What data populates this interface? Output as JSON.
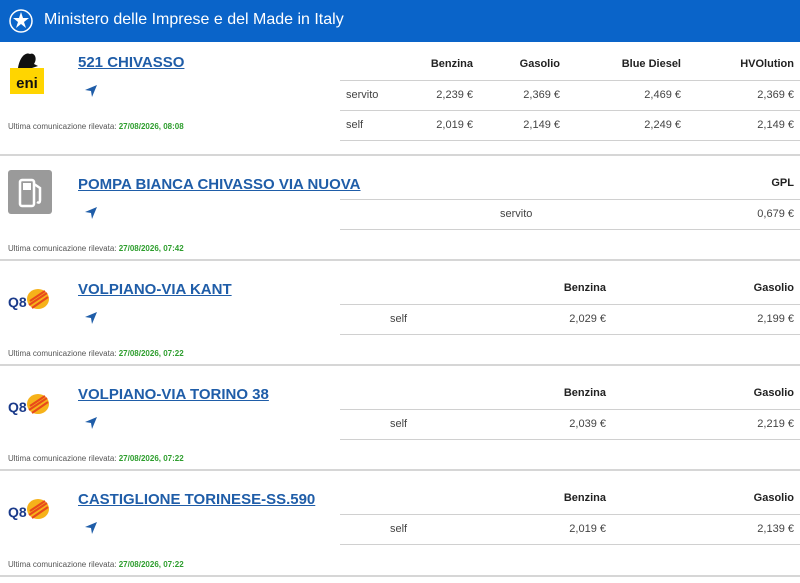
{
  "header": {
    "title": "Ministero delle Imprese e del Made in Italy"
  },
  "stations": [
    {
      "brand": "eni",
      "name": "521 CHIVASSO",
      "updated_label": "Ultima comunicazione rilevata:",
      "updated_value": "27/08/2026, 08:08",
      "fuels": [
        "Benzina",
        "Gasolio",
        "Blue Diesel",
        "HVOlution"
      ],
      "rows": [
        {
          "service": "servito",
          "prices": [
            "2,239 €",
            "2,369 €",
            "2,469 €",
            "2,369 €"
          ]
        },
        {
          "service": "self",
          "prices": [
            "2,019 €",
            "2,149 €",
            "2,249 €",
            "2,149 €"
          ]
        }
      ]
    },
    {
      "brand": "pompa-bianca",
      "name": "POMPA BIANCA CHIVASSO VIA NUOVA",
      "updated_label": "Ultima comunicazione rilevata:",
      "updated_value": "27/08/2026, 07:42",
      "fuels": [
        "GPL"
      ],
      "rows": [
        {
          "service": "servito",
          "prices": [
            "0,679 €"
          ]
        }
      ]
    },
    {
      "brand": "q8",
      "name": "VOLPIANO-VIA KANT",
      "updated_label": "Ultima comunicazione rilevata:",
      "updated_value": "27/08/2026, 07:22",
      "fuels": [
        "Benzina",
        "Gasolio"
      ],
      "rows": [
        {
          "service": "self",
          "prices": [
            "2,029 €",
            "2,199 €"
          ]
        }
      ]
    },
    {
      "brand": "q8",
      "name": "VOLPIANO-VIA TORINO 38",
      "updated_label": "Ultima comunicazione rilevata:",
      "updated_value": "27/08/2026, 07:22",
      "fuels": [
        "Benzina",
        "Gasolio"
      ],
      "rows": [
        {
          "service": "self",
          "prices": [
            "2,039 €",
            "2,219 €"
          ]
        }
      ]
    },
    {
      "brand": "q8",
      "name": "CASTIGLIONE TORINESE-SS.590",
      "updated_label": "Ultima comunicazione rilevata:",
      "updated_value": "27/08/2026, 07:22",
      "fuels": [
        "Benzina",
        "Gasolio"
      ],
      "rows": [
        {
          "service": "self",
          "prices": [
            "2,019 €",
            "2,139 €"
          ]
        }
      ]
    }
  ],
  "brand_logos": {
    "eni": {
      "text": "eni",
      "bg": "#ffd500",
      "fg": "#111111"
    },
    "q8": {
      "text": "Q8",
      "fg": "#1a3a8a",
      "accent": "#e84a1a"
    },
    "pompa-bianca": {
      "bg": "#9a9a9a",
      "fg": "#ffffff"
    }
  },
  "colors": {
    "header_bg": "#0a64c9",
    "link": "#1f5da8",
    "timestamp": "#2e9e2e"
  }
}
